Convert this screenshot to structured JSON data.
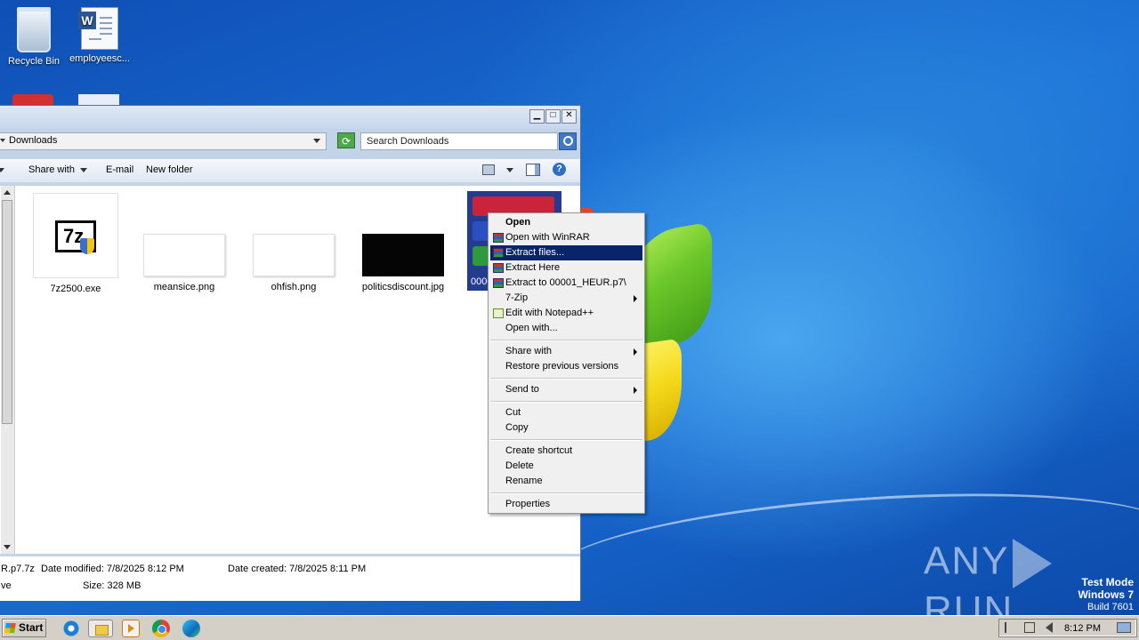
{
  "desktop": {
    "icons": [
      {
        "label": "Recycle Bin"
      },
      {
        "label": "employeesc..."
      }
    ],
    "watermark": "ANY RUN",
    "test_mode": {
      "line1": "Test Mode",
      "line2": "Windows 7",
      "line3": "Build 7601"
    }
  },
  "explorer": {
    "address": "Downloads",
    "search_placeholder": "Search Downloads",
    "toolbar": {
      "share_with": "Share with",
      "email": "E-mail",
      "new_folder": "New folder"
    },
    "files": [
      {
        "name": "7z2500.exe"
      },
      {
        "name": "meansice.png"
      },
      {
        "name": "ohfish.png"
      },
      {
        "name": "politicsdiscount.jpg"
      },
      {
        "name": "0000"
      }
    ],
    "details": {
      "name_fragment": "R.p7.7z",
      "type_fragment": "ve",
      "date_modified": "Date modified: 7/8/2025 8:12 PM",
      "size": "Size: 328 MB",
      "date_created": "Date created: 7/8/2025 8:11 PM"
    }
  },
  "context_menu": {
    "open": "Open",
    "open_winrar": "Open with WinRAR",
    "extract_files": "Extract files...",
    "extract_here": "Extract Here",
    "extract_to": "Extract to 00001_HEUR.p7\\",
    "seven_zip": "7-Zip",
    "edit_notepad": "Edit with Notepad++",
    "open_with": "Open with...",
    "share_with": "Share with",
    "restore": "Restore previous versions",
    "send_to": "Send to",
    "cut": "Cut",
    "copy": "Copy",
    "create_shortcut": "Create shortcut",
    "delete": "Delete",
    "rename": "Rename",
    "properties": "Properties"
  },
  "taskbar": {
    "start": "Start",
    "clock": "8:12 PM"
  }
}
